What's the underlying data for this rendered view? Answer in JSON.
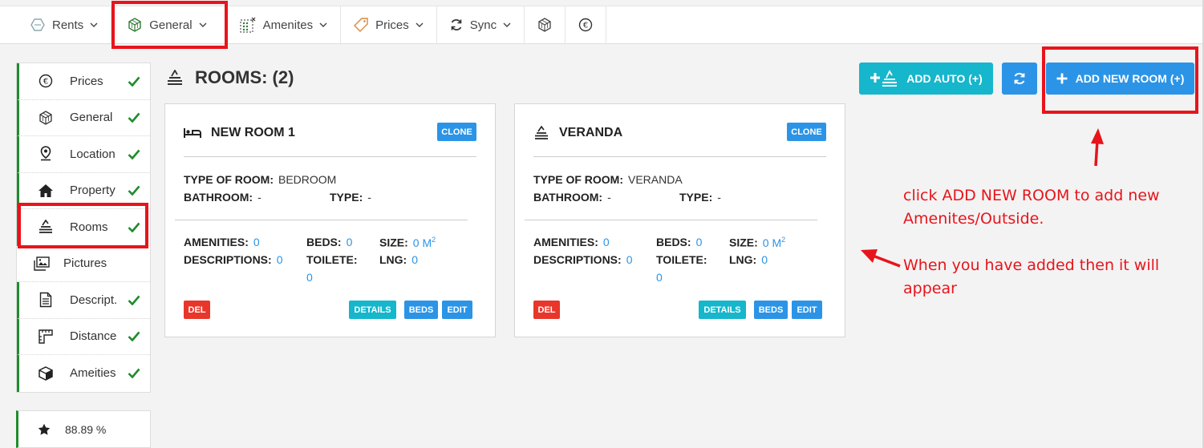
{
  "topbar": {
    "tabs": [
      {
        "label": "Rents",
        "icon": "hexagon-icon"
      },
      {
        "label": "General",
        "icon": "cube-icon"
      },
      {
        "label": "Amenites",
        "icon": "grid-dots-icon"
      },
      {
        "label": "Prices",
        "icon": "price-tag-icon"
      },
      {
        "label": "Sync",
        "icon": "sync-icon"
      },
      {
        "label": "",
        "icon": "cube-icon"
      },
      {
        "label": "",
        "icon": "euro-icon"
      }
    ]
  },
  "sidebar": {
    "items": [
      {
        "label": "Prices",
        "icon": "euro-icon",
        "done": true
      },
      {
        "label": "General",
        "icon": "cube-icon",
        "done": true
      },
      {
        "label": "Location",
        "icon": "map-pin-icon",
        "done": true
      },
      {
        "label": "Property",
        "icon": "house-icon",
        "done": true
      },
      {
        "label": "Rooms",
        "icon": "room-stack-icon",
        "done": true
      },
      {
        "label": "Pictures",
        "icon": "pictures-icon",
        "done": false
      },
      {
        "label": "Descript.",
        "icon": "document-icon",
        "done": true
      },
      {
        "label": "Distance",
        "icon": "ruler-icon",
        "done": true
      },
      {
        "label": "Ameities",
        "icon": "box-icon",
        "done": true
      }
    ],
    "score": "88.89 %"
  },
  "header": {
    "title": "ROOMS: (2)",
    "add_auto_label": "ADD AUTO (+)",
    "add_new_label": "ADD NEW ROOM (+)"
  },
  "rooms": [
    {
      "name": "NEW ROOM 1",
      "icon": "bed-icon",
      "clone_label": "CLONE",
      "type_of_room_label": "TYPE OF ROOM:",
      "type_of_room": "BEDROOM",
      "bathroom_label": "BATHROOM:",
      "bathroom": "-",
      "type_label": "TYPE:",
      "type": "-",
      "amenities_label": "AMENITIES:",
      "amenities": "0",
      "descriptions_label": "DESCRIPTIONS:",
      "descriptions": "0",
      "beds_label": "BEDS:",
      "beds": "0",
      "toilete_label": "TOILETE:",
      "toilete": "0",
      "size_label": "SIZE:",
      "size": "0 M",
      "size_unit_sup": "2",
      "lng_label": "LNG:",
      "lng": "0",
      "del_label": "DEL",
      "details_label": "DETAILS",
      "beds_btn_label": "BEDS",
      "edit_label": "EDIT"
    },
    {
      "name": "VERANDA",
      "icon": "room-stack-icon",
      "clone_label": "CLONE",
      "type_of_room_label": "TYPE OF ROOM:",
      "type_of_room": "VERANDA",
      "bathroom_label": "BATHROOM:",
      "bathroom": "-",
      "type_label": "TYPE:",
      "type": "-",
      "amenities_label": "AMENITIES:",
      "amenities": "0",
      "descriptions_label": "DESCRIPTIONS:",
      "descriptions": "0",
      "beds_label": "BEDS:",
      "beds": "0",
      "toilete_label": "TOILETE:",
      "toilete": "0",
      "size_label": "SIZE:",
      "size": "0 M",
      "size_unit_sup": "2",
      "lng_label": "LNG:",
      "lng": "0",
      "del_label": "DEL",
      "details_label": "DETAILS",
      "beds_btn_label": "BEDS",
      "edit_label": "EDIT"
    }
  ],
  "annotations": {
    "note1_line1": "click ADD NEW ROOM to add new",
    "note1_line2": "Amenites/Outside.",
    "note2_line1": "When you have added then it will",
    "note2_line2": "appear"
  },
  "colors": {
    "accent_blue": "#2b94e6",
    "accent_teal": "#16b6cc",
    "done_green": "#1e8c2c",
    "annotation_red": "#e8141b"
  }
}
